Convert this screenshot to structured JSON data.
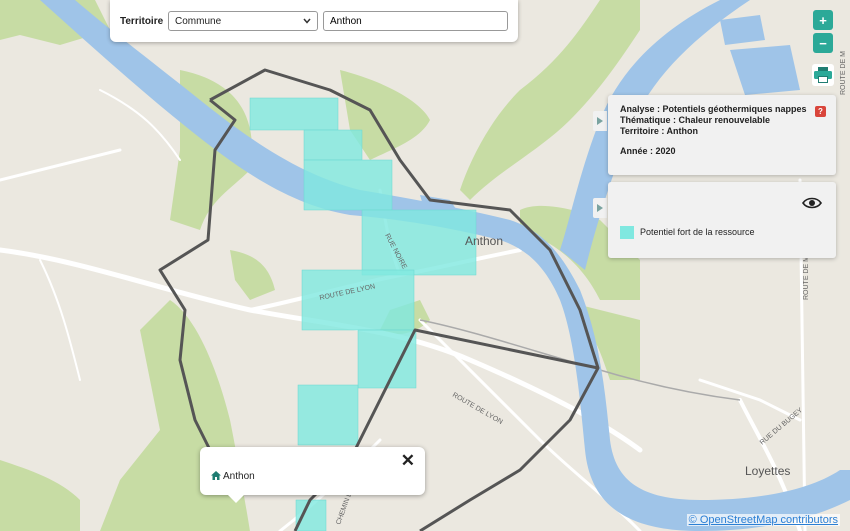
{
  "filter": {
    "territory_label": "Territoire",
    "type_value": "Commune",
    "name_value": "Anthon"
  },
  "zoom": {
    "in": "+",
    "out": "−"
  },
  "info": {
    "analysis": "Analyse : Potentiels géothermiques nappes",
    "theme": "Thématique : Chaleur renouvelable",
    "territory": "Territoire : Anthon",
    "year": "Année : 2020",
    "help": "?"
  },
  "legend": {
    "items": [
      {
        "label": "Potentiel fort de la ressource",
        "color": "#80e8e0"
      }
    ]
  },
  "popup": {
    "text": "Anthon",
    "close": "✕"
  },
  "map_labels": {
    "anthon": "Anthon",
    "loyettes": "Loyettes",
    "route_de_lyon_1": "ROUTE DE LYON",
    "route_de_lyon_2": "ROUTE DE LYON",
    "rue_noire": "RUE NOIRE",
    "chemin": "CHEMIN DE",
    "rue_du_bugey": "RUE DU BUGEY",
    "route_de_m": "ROUTE DE M",
    "route_de_m_top": "ROUTE DE M"
  },
  "attribution": "© OpenStreetMap contributors",
  "colors": {
    "water": "#9fc4e8",
    "land": "#ebe8e0",
    "forest": "#c7dca4",
    "potential": "#80e8e0",
    "accent": "#2ba998"
  }
}
